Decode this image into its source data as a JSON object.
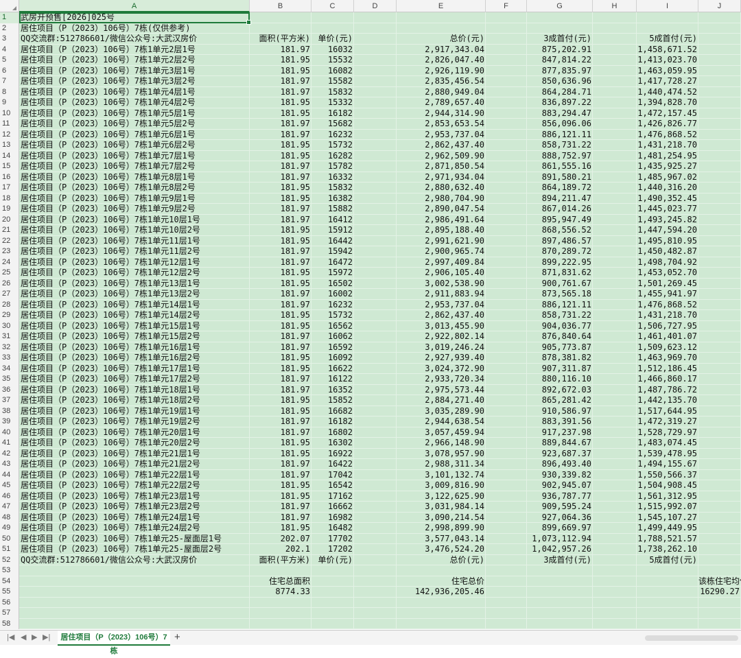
{
  "columns": [
    "A",
    "B",
    "C",
    "D",
    "E",
    "F",
    "G",
    "H",
    "I",
    "J"
  ],
  "selected_column": "A",
  "active_row": 1,
  "row_numbers": [
    1,
    2,
    3,
    4,
    5,
    6,
    7,
    8,
    9,
    10,
    11,
    12,
    13,
    14,
    15,
    16,
    17,
    18,
    19,
    20,
    21,
    22,
    23,
    24,
    25,
    26,
    27,
    28,
    29,
    30,
    31,
    32,
    33,
    34,
    35,
    36,
    37,
    38,
    39,
    40,
    41,
    42,
    43,
    44,
    45,
    46,
    47,
    48,
    49,
    50,
    51,
    52,
    53,
    54,
    55,
    56,
    57,
    58
  ],
  "rows": [
    {
      "a": "武房开预售[2026]025号",
      "b": "",
      "c": "",
      "e": "",
      "g": "",
      "i": "",
      "j": ""
    },
    {
      "a": "居住项目（P（2023）106号）7栋(仅供参考)",
      "b": "",
      "c": "",
      "e": "",
      "g": "",
      "i": "",
      "j": ""
    },
    {
      "a": "QQ交流群:512786601/微信公众号:大武汉房价",
      "b": "面积(平方米)",
      "c": "单价(元)",
      "e": "总价(元)",
      "g": "3成首付(元)",
      "i": "5成首付(元)",
      "j": ""
    },
    {
      "a": "居住项目（P（2023）106号）7栋1单元2层1号",
      "b": "181.97",
      "c": "16032",
      "e": "2,917,343.04",
      "g": "875,202.91",
      "i": "1,458,671.52",
      "j": ""
    },
    {
      "a": "居住项目（P（2023）106号）7栋1单元2层2号",
      "b": "181.95",
      "c": "15532",
      "e": "2,826,047.40",
      "g": "847,814.22",
      "i": "1,413,023.70",
      "j": ""
    },
    {
      "a": "居住项目（P（2023）106号）7栋1单元3层1号",
      "b": "181.95",
      "c": "16082",
      "e": "2,926,119.90",
      "g": "877,835.97",
      "i": "1,463,059.95",
      "j": ""
    },
    {
      "a": "居住项目（P（2023）106号）7栋1单元3层2号",
      "b": "181.97",
      "c": "15582",
      "e": "2,835,456.54",
      "g": "850,636.96",
      "i": "1,417,728.27",
      "j": ""
    },
    {
      "a": "居住项目（P（2023）106号）7栋1单元4层1号",
      "b": "181.97",
      "c": "15832",
      "e": "2,880,949.04",
      "g": "864,284.71",
      "i": "1,440,474.52",
      "j": ""
    },
    {
      "a": "居住项目（P（2023）106号）7栋1单元4层2号",
      "b": "181.95",
      "c": "15332",
      "e": "2,789,657.40",
      "g": "836,897.22",
      "i": "1,394,828.70",
      "j": ""
    },
    {
      "a": "居住项目（P（2023）106号）7栋1单元5层1号",
      "b": "181.95",
      "c": "16182",
      "e": "2,944,314.90",
      "g": "883,294.47",
      "i": "1,472,157.45",
      "j": ""
    },
    {
      "a": "居住项目（P（2023）106号）7栋1单元5层2号",
      "b": "181.97",
      "c": "15682",
      "e": "2,853,653.54",
      "g": "856,096.06",
      "i": "1,426,826.77",
      "j": ""
    },
    {
      "a": "居住项目（P（2023）106号）7栋1单元6层1号",
      "b": "181.97",
      "c": "16232",
      "e": "2,953,737.04",
      "g": "886,121.11",
      "i": "1,476,868.52",
      "j": ""
    },
    {
      "a": "居住项目（P（2023）106号）7栋1单元6层2号",
      "b": "181.95",
      "c": "15732",
      "e": "2,862,437.40",
      "g": "858,731.22",
      "i": "1,431,218.70",
      "j": ""
    },
    {
      "a": "居住项目（P（2023）106号）7栋1单元7层1号",
      "b": "181.95",
      "c": "16282",
      "e": "2,962,509.90",
      "g": "888,752.97",
      "i": "1,481,254.95",
      "j": ""
    },
    {
      "a": "居住项目（P（2023）106号）7栋1单元7层2号",
      "b": "181.97",
      "c": "15782",
      "e": "2,871,850.54",
      "g": "861,555.16",
      "i": "1,435,925.27",
      "j": ""
    },
    {
      "a": "居住项目（P（2023）106号）7栋1单元8层1号",
      "b": "181.97",
      "c": "16332",
      "e": "2,971,934.04",
      "g": "891,580.21",
      "i": "1,485,967.02",
      "j": ""
    },
    {
      "a": "居住项目（P（2023）106号）7栋1单元8层2号",
      "b": "181.95",
      "c": "15832",
      "e": "2,880,632.40",
      "g": "864,189.72",
      "i": "1,440,316.20",
      "j": ""
    },
    {
      "a": "居住项目（P（2023）106号）7栋1单元9层1号",
      "b": "181.95",
      "c": "16382",
      "e": "2,980,704.90",
      "g": "894,211.47",
      "i": "1,490,352.45",
      "j": ""
    },
    {
      "a": "居住项目（P（2023）106号）7栋1单元9层2号",
      "b": "181.97",
      "c": "15882",
      "e": "2,890,047.54",
      "g": "867,014.26",
      "i": "1,445,023.77",
      "j": ""
    },
    {
      "a": "居住项目（P（2023）106号）7栋1单元10层1号",
      "b": "181.97",
      "c": "16412",
      "e": "2,986,491.64",
      "g": "895,947.49",
      "i": "1,493,245.82",
      "j": ""
    },
    {
      "a": "居住项目（P（2023）106号）7栋1单元10层2号",
      "b": "181.95",
      "c": "15912",
      "e": "2,895,188.40",
      "g": "868,556.52",
      "i": "1,447,594.20",
      "j": ""
    },
    {
      "a": "居住项目（P（2023）106号）7栋1单元11层1号",
      "b": "181.95",
      "c": "16442",
      "e": "2,991,621.90",
      "g": "897,486.57",
      "i": "1,495,810.95",
      "j": ""
    },
    {
      "a": "居住项目（P（2023）106号）7栋1单元11层2号",
      "b": "181.97",
      "c": "15942",
      "e": "2,900,965.74",
      "g": "870,289.72",
      "i": "1,450,482.87",
      "j": ""
    },
    {
      "a": "居住项目（P（2023）106号）7栋1单元12层1号",
      "b": "181.97",
      "c": "16472",
      "e": "2,997,409.84",
      "g": "899,222.95",
      "i": "1,498,704.92",
      "j": ""
    },
    {
      "a": "居住项目（P（2023）106号）7栋1单元12层2号",
      "b": "181.95",
      "c": "15972",
      "e": "2,906,105.40",
      "g": "871,831.62",
      "i": "1,453,052.70",
      "j": ""
    },
    {
      "a": "居住项目（P（2023）106号）7栋1单元13层1号",
      "b": "181.95",
      "c": "16502",
      "e": "3,002,538.90",
      "g": "900,761.67",
      "i": "1,501,269.45",
      "j": ""
    },
    {
      "a": "居住项目（P（2023）106号）7栋1单元13层2号",
      "b": "181.97",
      "c": "16002",
      "e": "2,911,883.94",
      "g": "873,565.18",
      "i": "1,455,941.97",
      "j": ""
    },
    {
      "a": "居住项目（P（2023）106号）7栋1单元14层1号",
      "b": "181.97",
      "c": "16232",
      "e": "2,953,737.04",
      "g": "886,121.11",
      "i": "1,476,868.52",
      "j": ""
    },
    {
      "a": "居住项目（P（2023）106号）7栋1单元14层2号",
      "b": "181.95",
      "c": "15732",
      "e": "2,862,437.40",
      "g": "858,731.22",
      "i": "1,431,218.70",
      "j": ""
    },
    {
      "a": "居住项目（P（2023）106号）7栋1单元15层1号",
      "b": "181.95",
      "c": "16562",
      "e": "3,013,455.90",
      "g": "904,036.77",
      "i": "1,506,727.95",
      "j": ""
    },
    {
      "a": "居住项目（P（2023）106号）7栋1单元15层2号",
      "b": "181.97",
      "c": "16062",
      "e": "2,922,802.14",
      "g": "876,840.64",
      "i": "1,461,401.07",
      "j": ""
    },
    {
      "a": "居住项目（P（2023）106号）7栋1单元16层1号",
      "b": "181.97",
      "c": "16592",
      "e": "3,019,246.24",
      "g": "905,773.87",
      "i": "1,509,623.12",
      "j": ""
    },
    {
      "a": "居住项目（P（2023）106号）7栋1单元16层2号",
      "b": "181.95",
      "c": "16092",
      "e": "2,927,939.40",
      "g": "878,381.82",
      "i": "1,463,969.70",
      "j": ""
    },
    {
      "a": "居住项目（P（2023）106号）7栋1单元17层1号",
      "b": "181.95",
      "c": "16622",
      "e": "3,024,372.90",
      "g": "907,311.87",
      "i": "1,512,186.45",
      "j": ""
    },
    {
      "a": "居住项目（P（2023）106号）7栋1单元17层2号",
      "b": "181.97",
      "c": "16122",
      "e": "2,933,720.34",
      "g": "880,116.10",
      "i": "1,466,860.17",
      "j": ""
    },
    {
      "a": "居住项目（P（2023）106号）7栋1单元18层1号",
      "b": "181.97",
      "c": "16352",
      "e": "2,975,573.44",
      "g": "892,672.03",
      "i": "1,487,786.72",
      "j": ""
    },
    {
      "a": "居住项目（P（2023）106号）7栋1单元18层2号",
      "b": "181.95",
      "c": "15852",
      "e": "2,884,271.40",
      "g": "865,281.42",
      "i": "1,442,135.70",
      "j": ""
    },
    {
      "a": "居住项目（P（2023）106号）7栋1单元19层1号",
      "b": "181.95",
      "c": "16682",
      "e": "3,035,289.90",
      "g": "910,586.97",
      "i": "1,517,644.95",
      "j": ""
    },
    {
      "a": "居住项目（P（2023）106号）7栋1单元19层2号",
      "b": "181.97",
      "c": "16182",
      "e": "2,944,638.54",
      "g": "883,391.56",
      "i": "1,472,319.27",
      "j": ""
    },
    {
      "a": "居住项目（P（2023）106号）7栋1单元20层1号",
      "b": "181.97",
      "c": "16802",
      "e": "3,057,459.94",
      "g": "917,237.98",
      "i": "1,528,729.97",
      "j": ""
    },
    {
      "a": "居住项目（P（2023）106号）7栋1单元20层2号",
      "b": "181.95",
      "c": "16302",
      "e": "2,966,148.90",
      "g": "889,844.67",
      "i": "1,483,074.45",
      "j": ""
    },
    {
      "a": "居住项目（P（2023）106号）7栋1单元21层1号",
      "b": "181.95",
      "c": "16922",
      "e": "3,078,957.90",
      "g": "923,687.37",
      "i": "1,539,478.95",
      "j": ""
    },
    {
      "a": "居住项目（P（2023）106号）7栋1单元21层2号",
      "b": "181.97",
      "c": "16422",
      "e": "2,988,311.34",
      "g": "896,493.40",
      "i": "1,494,155.67",
      "j": ""
    },
    {
      "a": "居住项目（P（2023）106号）7栋1单元22层1号",
      "b": "181.97",
      "c": "17042",
      "e": "3,101,132.74",
      "g": "930,339.82",
      "i": "1,550,566.37",
      "j": ""
    },
    {
      "a": "居住项目（P（2023）106号）7栋1单元22层2号",
      "b": "181.95",
      "c": "16542",
      "e": "3,009,816.90",
      "g": "902,945.07",
      "i": "1,504,908.45",
      "j": ""
    },
    {
      "a": "居住项目（P（2023）106号）7栋1单元23层1号",
      "b": "181.95",
      "c": "17162",
      "e": "3,122,625.90",
      "g": "936,787.77",
      "i": "1,561,312.95",
      "j": ""
    },
    {
      "a": "居住项目（P（2023）106号）7栋1单元23层2号",
      "b": "181.97",
      "c": "16662",
      "e": "3,031,984.14",
      "g": "909,595.24",
      "i": "1,515,992.07",
      "j": ""
    },
    {
      "a": "居住项目（P（2023）106号）7栋1单元24层1号",
      "b": "181.97",
      "c": "16982",
      "e": "3,090,214.54",
      "g": "927,064.36",
      "i": "1,545,107.27",
      "j": ""
    },
    {
      "a": "居住项目（P（2023）106号）7栋1单元24层2号",
      "b": "181.95",
      "c": "16482",
      "e": "2,998,899.90",
      "g": "899,669.97",
      "i": "1,499,449.95",
      "j": ""
    },
    {
      "a": "居住项目（P（2023）106号）7栋1单元25-屋面层1号",
      "b": "202.07",
      "c": "17702",
      "e": "3,577,043.14",
      "g": "1,073,112.94",
      "i": "1,788,521.57",
      "j": ""
    },
    {
      "a": "居住项目（P（2023）106号）7栋1单元25-屋面层2号",
      "b": "202.1",
      "c": "17202",
      "e": "3,476,524.20",
      "g": "1,042,957.26",
      "i": "1,738,262.10",
      "j": ""
    },
    {
      "a": "QQ交流群:512786601/微信公众号:大武汉房价",
      "b": "面积(平方米)",
      "c": "单价(元)",
      "e": "总价(元)",
      "g": "3成首付(元)",
      "i": "5成首付(元)",
      "j": ""
    },
    {
      "a": "",
      "b": "",
      "c": "",
      "e": "",
      "g": "",
      "i": "",
      "j": ""
    },
    {
      "a": "",
      "b": "住宅总面积",
      "c": "",
      "e": "住宅总价",
      "g": "",
      "i": "",
      "j": "该栋住宅均价"
    },
    {
      "a": "",
      "b": "8774.33",
      "c": "",
      "e": "142,936,205.46",
      "g": "",
      "i": "",
      "j": "16290.27"
    },
    {
      "a": "",
      "b": "",
      "c": "",
      "e": "",
      "g": "",
      "i": "",
      "j": ""
    },
    {
      "a": "",
      "b": "",
      "c": "",
      "e": "",
      "g": "",
      "i": "",
      "j": ""
    },
    {
      "a": "",
      "b": "",
      "c": "",
      "e": "",
      "g": "",
      "i": "",
      "j": ""
    }
  ],
  "sheet_tab": {
    "label": "居住项目（P（2023）106号）7栋",
    "add_label": "+"
  },
  "nav": {
    "first": "|◀",
    "prev": "◀",
    "next": "▶",
    "last": "▶|"
  },
  "colors": {
    "cell_fill": "#cfe9d3",
    "accent": "#1e7a3a"
  }
}
